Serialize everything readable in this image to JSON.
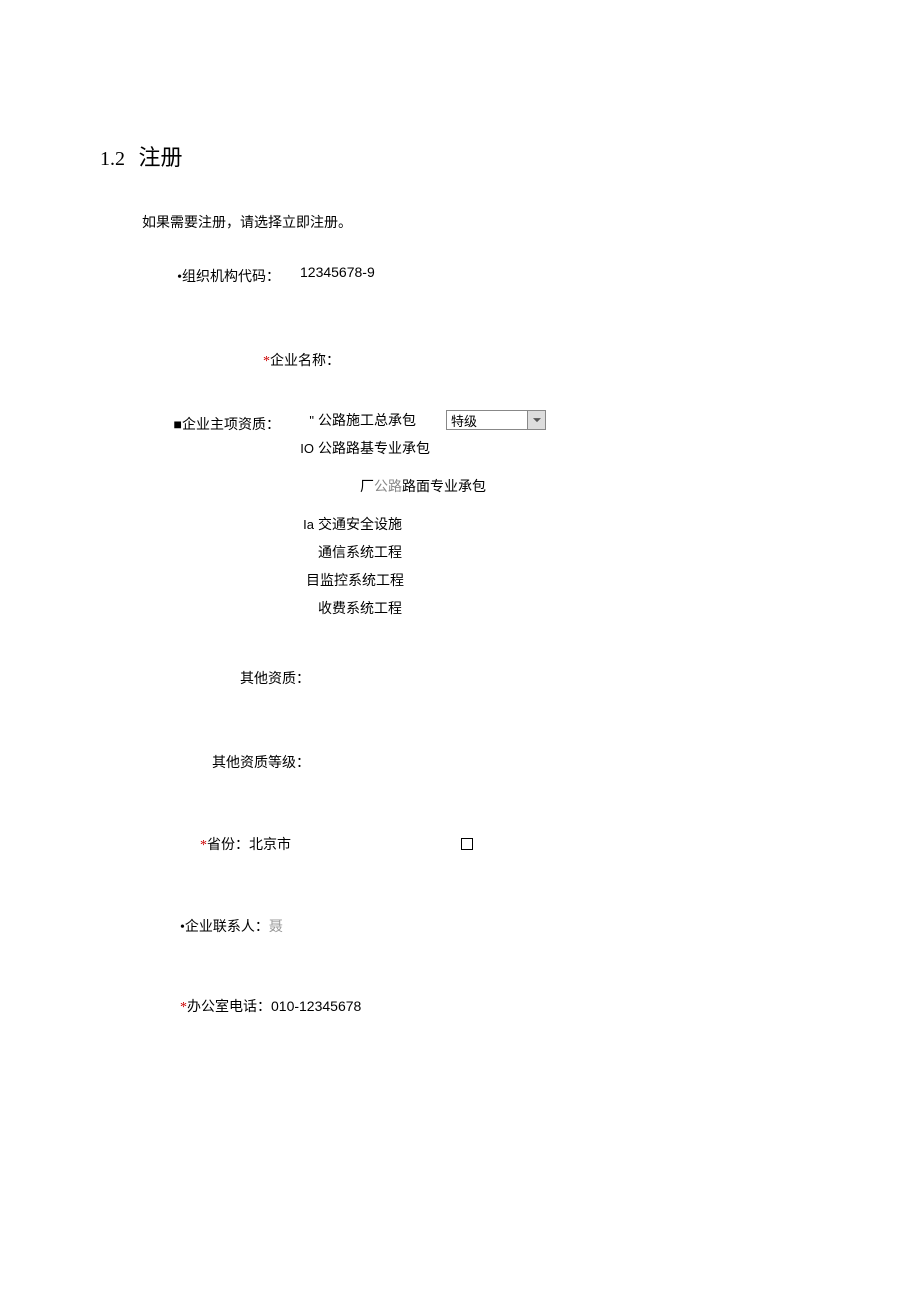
{
  "heading": {
    "number": "1.2",
    "title": "注册"
  },
  "intro": "如果需要注册，请选择立即注册。",
  "fields": {
    "org_code": {
      "label": "•组织机构代码：",
      "value": "12345678-9"
    },
    "company_name": {
      "star": "*",
      "label": "企业名称："
    },
    "main_qualification": {
      "bullet": "■",
      "label": "企业主项资质："
    },
    "other_qualification": {
      "label": "其他资质："
    },
    "other_qualification_level": {
      "label": "其他资质等级："
    },
    "province": {
      "star": "*",
      "label": "省份：",
      "value": "北京市"
    },
    "contact": {
      "bullet": "•",
      "label": "企业联系人：",
      "value": "聂"
    },
    "office_phone": {
      "star": "*",
      "label": "办公室电话：",
      "value": "010-12345678"
    }
  },
  "qualifications": {
    "item1_prefix": "\"",
    "item1": "公路施工总承包",
    "select_value": "特级",
    "item2_prefix": "IO",
    "item2": "公路路基专业承包",
    "item3_prefix": "厂",
    "item3_gray": "公路",
    "item3_rest": "路面专业承包",
    "item4_prefix": "Ia",
    "item4": "交通安全设施",
    "item5": "通信系统工程",
    "item6": "目监控系统工程",
    "item7": "收费系统工程"
  }
}
